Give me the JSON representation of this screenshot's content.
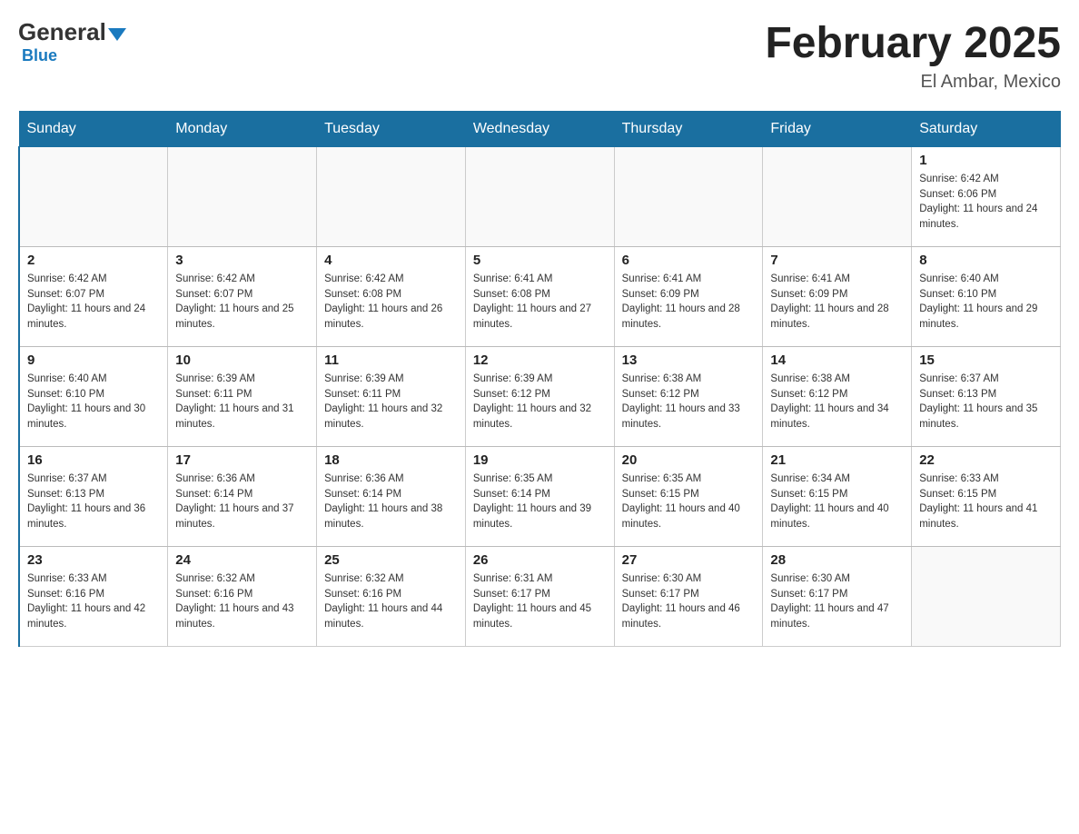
{
  "header": {
    "logo_general": "General",
    "logo_blue": "Blue",
    "month_title": "February 2025",
    "location": "El Ambar, Mexico"
  },
  "days_of_week": [
    "Sunday",
    "Monday",
    "Tuesday",
    "Wednesday",
    "Thursday",
    "Friday",
    "Saturday"
  ],
  "weeks": [
    [
      {
        "day": "",
        "empty": true
      },
      {
        "day": "",
        "empty": true
      },
      {
        "day": "",
        "empty": true
      },
      {
        "day": "",
        "empty": true
      },
      {
        "day": "",
        "empty": true
      },
      {
        "day": "",
        "empty": true
      },
      {
        "day": "1",
        "sunrise": "6:42 AM",
        "sunset": "6:06 PM",
        "daylight": "11 hours and 24 minutes."
      }
    ],
    [
      {
        "day": "2",
        "sunrise": "6:42 AM",
        "sunset": "6:07 PM",
        "daylight": "11 hours and 24 minutes."
      },
      {
        "day": "3",
        "sunrise": "6:42 AM",
        "sunset": "6:07 PM",
        "daylight": "11 hours and 25 minutes."
      },
      {
        "day": "4",
        "sunrise": "6:42 AM",
        "sunset": "6:08 PM",
        "daylight": "11 hours and 26 minutes."
      },
      {
        "day": "5",
        "sunrise": "6:41 AM",
        "sunset": "6:08 PM",
        "daylight": "11 hours and 27 minutes."
      },
      {
        "day": "6",
        "sunrise": "6:41 AM",
        "sunset": "6:09 PM",
        "daylight": "11 hours and 28 minutes."
      },
      {
        "day": "7",
        "sunrise": "6:41 AM",
        "sunset": "6:09 PM",
        "daylight": "11 hours and 28 minutes."
      },
      {
        "day": "8",
        "sunrise": "6:40 AM",
        "sunset": "6:10 PM",
        "daylight": "11 hours and 29 minutes."
      }
    ],
    [
      {
        "day": "9",
        "sunrise": "6:40 AM",
        "sunset": "6:10 PM",
        "daylight": "11 hours and 30 minutes."
      },
      {
        "day": "10",
        "sunrise": "6:39 AM",
        "sunset": "6:11 PM",
        "daylight": "11 hours and 31 minutes."
      },
      {
        "day": "11",
        "sunrise": "6:39 AM",
        "sunset": "6:11 PM",
        "daylight": "11 hours and 32 minutes."
      },
      {
        "day": "12",
        "sunrise": "6:39 AM",
        "sunset": "6:12 PM",
        "daylight": "11 hours and 32 minutes."
      },
      {
        "day": "13",
        "sunrise": "6:38 AM",
        "sunset": "6:12 PM",
        "daylight": "11 hours and 33 minutes."
      },
      {
        "day": "14",
        "sunrise": "6:38 AM",
        "sunset": "6:12 PM",
        "daylight": "11 hours and 34 minutes."
      },
      {
        "day": "15",
        "sunrise": "6:37 AM",
        "sunset": "6:13 PM",
        "daylight": "11 hours and 35 minutes."
      }
    ],
    [
      {
        "day": "16",
        "sunrise": "6:37 AM",
        "sunset": "6:13 PM",
        "daylight": "11 hours and 36 minutes."
      },
      {
        "day": "17",
        "sunrise": "6:36 AM",
        "sunset": "6:14 PM",
        "daylight": "11 hours and 37 minutes."
      },
      {
        "day": "18",
        "sunrise": "6:36 AM",
        "sunset": "6:14 PM",
        "daylight": "11 hours and 38 minutes."
      },
      {
        "day": "19",
        "sunrise": "6:35 AM",
        "sunset": "6:14 PM",
        "daylight": "11 hours and 39 minutes."
      },
      {
        "day": "20",
        "sunrise": "6:35 AM",
        "sunset": "6:15 PM",
        "daylight": "11 hours and 40 minutes."
      },
      {
        "day": "21",
        "sunrise": "6:34 AM",
        "sunset": "6:15 PM",
        "daylight": "11 hours and 40 minutes."
      },
      {
        "day": "22",
        "sunrise": "6:33 AM",
        "sunset": "6:15 PM",
        "daylight": "11 hours and 41 minutes."
      }
    ],
    [
      {
        "day": "23",
        "sunrise": "6:33 AM",
        "sunset": "6:16 PM",
        "daylight": "11 hours and 42 minutes."
      },
      {
        "day": "24",
        "sunrise": "6:32 AM",
        "sunset": "6:16 PM",
        "daylight": "11 hours and 43 minutes."
      },
      {
        "day": "25",
        "sunrise": "6:32 AM",
        "sunset": "6:16 PM",
        "daylight": "11 hours and 44 minutes."
      },
      {
        "day": "26",
        "sunrise": "6:31 AM",
        "sunset": "6:17 PM",
        "daylight": "11 hours and 45 minutes."
      },
      {
        "day": "27",
        "sunrise": "6:30 AM",
        "sunset": "6:17 PM",
        "daylight": "11 hours and 46 minutes."
      },
      {
        "day": "28",
        "sunrise": "6:30 AM",
        "sunset": "6:17 PM",
        "daylight": "11 hours and 47 minutes."
      },
      {
        "day": "",
        "empty": true
      }
    ]
  ]
}
